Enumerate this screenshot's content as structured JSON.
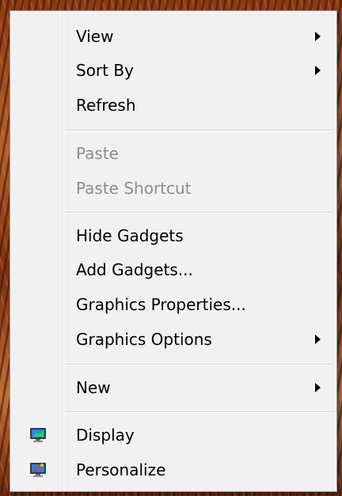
{
  "menu": {
    "view": {
      "label": "View",
      "has_submenu": true
    },
    "sort_by": {
      "label": "Sort By",
      "has_submenu": true
    },
    "refresh": {
      "label": "Refresh"
    },
    "paste": {
      "label": "Paste",
      "disabled": true
    },
    "paste_shortcut": {
      "label": "Paste Shortcut",
      "disabled": true
    },
    "hide_gadgets": {
      "label": "Hide Gadgets"
    },
    "add_gadgets": {
      "label": "Add Gadgets..."
    },
    "graphics_properties": {
      "label": "Graphics Properties..."
    },
    "graphics_options": {
      "label": "Graphics Options",
      "has_submenu": true
    },
    "new": {
      "label": "New",
      "has_submenu": true
    },
    "display": {
      "label": "Display",
      "icon": "display-monitor-icon"
    },
    "personalize": {
      "label": "Personalize",
      "icon": "personalize-monitor-icon"
    }
  },
  "colors": {
    "menu_bg": "#f1f1f1",
    "disabled_text": "#8d8d8d",
    "separator": "#d7d7d7"
  }
}
